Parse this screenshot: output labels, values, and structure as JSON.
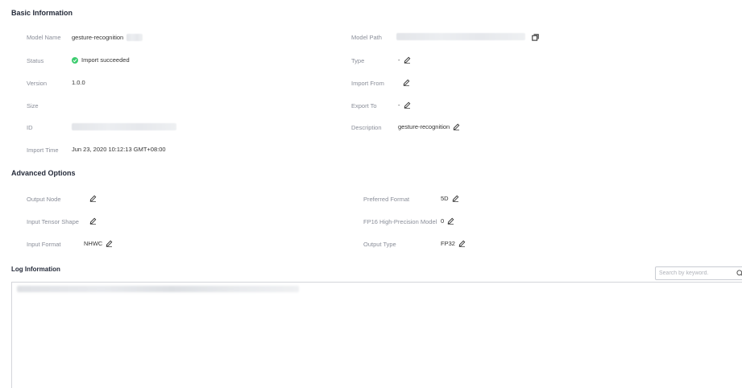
{
  "basic_info": {
    "title": "Basic Information",
    "left": [
      {
        "label": "Model Name",
        "value": "gesture-recognition"
      },
      {
        "label": "Status",
        "value": "Import succeeded"
      },
      {
        "label": "Version",
        "value": "1.0.0"
      },
      {
        "label": "Size",
        "value": ""
      },
      {
        "label": "ID",
        "value": ""
      },
      {
        "label": "Import Time",
        "value": "Jun 23, 2020 10:12:13 GMT+08:00"
      }
    ],
    "right": [
      {
        "label": "Model Path",
        "value": ""
      },
      {
        "label": "Type",
        "value": "-"
      },
      {
        "label": "Import From",
        "value": ""
      },
      {
        "label": "Export To",
        "value": "-"
      },
      {
        "label": "Description",
        "value": "gesture-recognition"
      }
    ]
  },
  "advanced": {
    "title": "Advanced Options",
    "left": [
      {
        "label": "Output Node",
        "value": ""
      },
      {
        "label": "Input Tensor Shape",
        "value": ""
      },
      {
        "label": "Input Format",
        "value": "NHWC"
      }
    ],
    "right": [
      {
        "label": "Preferred Format",
        "value": "5D"
      },
      {
        "label": "FP16 High-Precision Model",
        "value": "0"
      },
      {
        "label": "Output Type",
        "value": "FP32"
      }
    ]
  },
  "log": {
    "title": "Log Information",
    "search_placeholder": "Search by keyword."
  },
  "icons": {
    "edit": "pencil-edit-icon",
    "copy": "copy-icon",
    "search": "search-icon",
    "status": "check-circle-icon"
  },
  "colors": {
    "status_success": "#3dcc6f",
    "label": "#8a8e99",
    "title": "#252b3a"
  }
}
